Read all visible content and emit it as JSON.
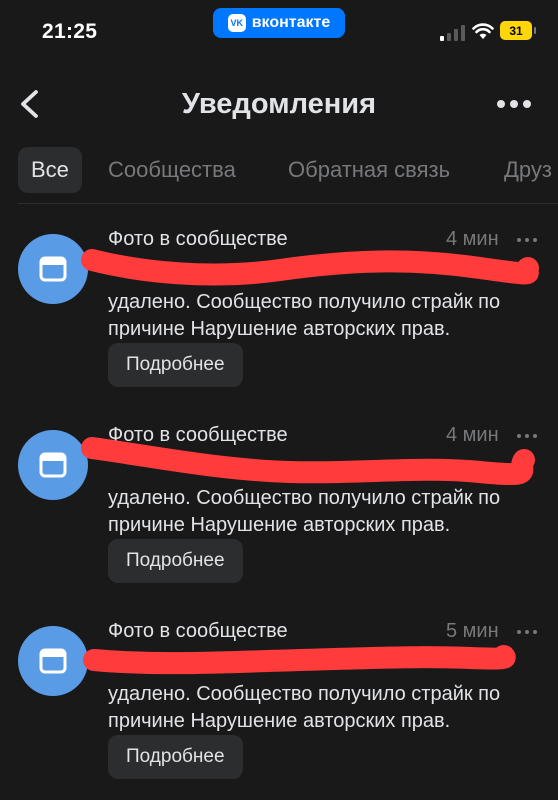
{
  "status_bar": {
    "time": "21:25",
    "app_badge": "вконтакте",
    "vk_logo": "VK",
    "battery": "31"
  },
  "header": {
    "title": "Уведомления",
    "back_icon": "chevron-left-icon",
    "more_icon": "ellipsis-icon"
  },
  "tabs": [
    {
      "label": "Все",
      "active": true
    },
    {
      "label": "Сообщества",
      "active": false
    },
    {
      "label": "Обратная связь",
      "active": false
    },
    {
      "label": "Друз",
      "active": false
    }
  ],
  "notifications": [
    {
      "title": "Фото в сообществе",
      "time": "4 мин",
      "body_line1": "удалено. Сообщество получило страйк по",
      "body_line2": "причине Нарушение авторских прав.",
      "button": "Подробнее",
      "icon": "window-icon"
    },
    {
      "title": "Фото в сообществе",
      "time": "4 мин",
      "body_line1": "удалено. Сообщество получило страйк по",
      "body_line2": "причине Нарушение авторских прав.",
      "button": "Подробнее",
      "icon": "window-icon"
    },
    {
      "title": "Фото в сообществе",
      "time": "5 мин",
      "body_line1": "удалено. Сообщество получило страйк по",
      "body_line2": "причине Нарушение авторских прав.",
      "button": "Подробнее",
      "icon": "window-icon"
    }
  ],
  "colors": {
    "background": "#19191a",
    "accent": "#0077ff",
    "avatar": "#5a9be6",
    "redaction": "#ff3b3b",
    "battery": "#ffd60a"
  }
}
